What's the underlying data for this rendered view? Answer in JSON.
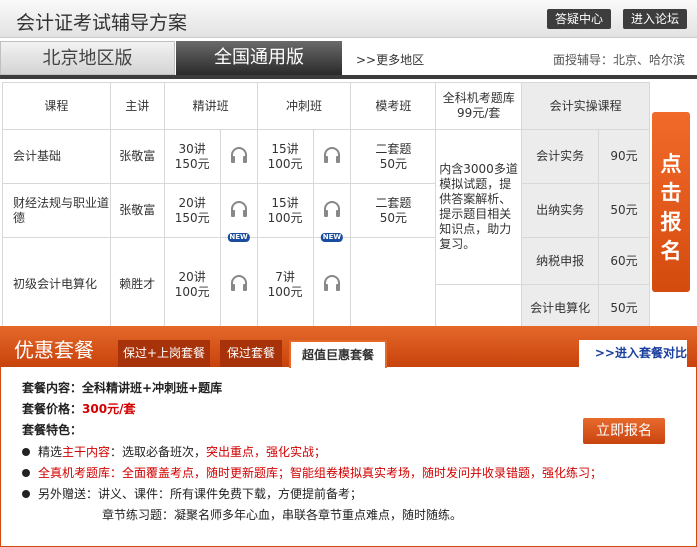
{
  "header": {
    "title": "会计证考试辅导方案",
    "qa_label": "答疑中心",
    "forum_label": "进入论坛"
  },
  "versions": {
    "beijing": "北京地区版",
    "national": "全国通用版",
    "more": ">>更多地区",
    "tutor": "面授辅导：北京、哈尔滨"
  },
  "table": {
    "headers": {
      "course": "课程",
      "teacher": "主讲",
      "jingjiang": "精讲班",
      "chongci": "冲刺班",
      "mokao": "模考班",
      "tiku": "全科机考题库\n99元/套",
      "shixun": "会计实操课程"
    },
    "rows": [
      {
        "course": "会计基础",
        "teacher": "张敬富",
        "jj1": "30讲",
        "jj2": "150元",
        "cc1": "15讲",
        "cc2": "100元",
        "mk1": "二套题",
        "mk2": "50元"
      },
      {
        "course": "财经法规与职业道德",
        "teacher": "张敬富",
        "jj1": "20讲",
        "jj2": "150元",
        "cc1": "15讲",
        "cc2": "100元",
        "mk1": "二套题",
        "mk2": "50元"
      },
      {
        "course": "初级会计电算化",
        "teacher": "赖胜才",
        "jj1": "20讲",
        "jj2": "100元",
        "cc1": "7讲",
        "cc2": "100元",
        "mk1": "",
        "mk2": ""
      }
    ],
    "tiku_desc": "内含3000多道模拟试题，提供答案解析、提示题目相关知识点，助力复习。",
    "shixun": [
      {
        "name": "会计实务",
        "price": "90元"
      },
      {
        "name": "出纳实务",
        "price": "50元"
      },
      {
        "name": "纳税申报",
        "price": "60元"
      },
      {
        "name": "会计电算化",
        "price": "50元"
      }
    ],
    "new_badge": "NEW",
    "signup": [
      "点",
      "击",
      "报",
      "名"
    ]
  },
  "package": {
    "title": "优惠套餐",
    "tabs": [
      "保过+上岗套餐",
      "保过套餐",
      "超值巨惠套餐"
    ],
    "compare": ">>进入套餐对比",
    "content_label": "套餐内容：",
    "content_value": "全科精讲班+冲刺班+题库",
    "price_label": "套餐价格：",
    "price_value": "300元/套",
    "feature_label": "套餐特色：",
    "features": [
      {
        "lead": "精选",
        "red1": "主干内容",
        "mid": "：选取必备班次，",
        "red2": "突出重点，强化实战；"
      },
      {
        "lead": "",
        "red1": "全真机考题库：全面覆盖考点，随时更新题库；智能组卷模拟真实考场，随时发问并收录错题，强化练习；",
        "mid": "",
        "red2": ""
      },
      {
        "lead": "另外赠送：讲义、课件：所有课件免费下载，方便提前备考；",
        "red1": "",
        "mid": "",
        "red2": ""
      }
    ],
    "extra": "章节练习题：凝聚名师多年心血，串联各章节重点难点，随时随练。",
    "signup_btn": "立即报名"
  }
}
